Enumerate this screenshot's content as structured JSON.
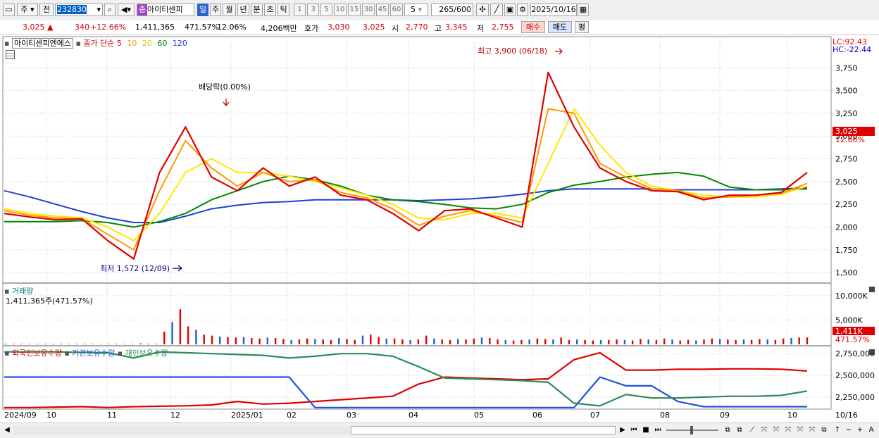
{
  "toolbar": {
    "market_btn": "주",
    "prev_btn": "전",
    "code_value": "232830",
    "name_badge": "종",
    "stock_name": "아이티센피",
    "period_day": "일",
    "period_week": "주",
    "period_month": "월",
    "period_year": "년",
    "period_minute": "분",
    "period_second": "초",
    "period_tick": "틱",
    "intervals": [
      "1",
      "3",
      "5",
      "10",
      "15",
      "30",
      "45",
      "60"
    ],
    "interval_value": "5",
    "count_value": "265",
    "count_total": "/600",
    "date_value": "2025/10/16"
  },
  "info": {
    "price": "3,025",
    "change_symbol": "▲",
    "change": "340",
    "change_pct": "+12.66%",
    "volume": "1,411,365",
    "volume_ratio": "471.57%",
    "turnover": "12.06%",
    "amount": "4,206백만",
    "bid_label": "호가",
    "bid1": "3,030",
    "bid2": "3,025",
    "open_label": "시",
    "open": "2,770",
    "high_label": "고",
    "high": "3,345",
    "low_label": "저",
    "low": "2,755",
    "buy_btn": "매수",
    "sell_btn": "매도",
    "eval_btn": "평"
  },
  "price_panel": {
    "title": "아이티센피엔에스",
    "ma_label": "종가 단순",
    "ma_periods": [
      "5",
      "10",
      "20",
      "60",
      "120"
    ],
    "lc": "LC:92.43",
    "hc": "HC:-22.44",
    "current_price_tag": "3,025",
    "current_pct_tag": "12.66%",
    "high_annotation": "최고 3,900 (06/18)",
    "low_annotation": "최저 1,572 (12/09)",
    "dividend_annotation": "배당락(0.00%)"
  },
  "volume_panel": {
    "title": "거래량",
    "value_line": "1,411,365주(471.57%)",
    "axis": [
      "10,000K",
      "5,000K"
    ],
    "current_tag": "1,411K",
    "pct_tag": "471.57%"
  },
  "holding_panel": {
    "legend_foreign": "외국인보유수량",
    "legend_inst": "기관보유수량",
    "legend_indiv": "개인보유수량",
    "axis": [
      "2,750,000",
      "2,500,000",
      "2,250,000"
    ]
  },
  "x_axis": [
    "2024/09",
    "10",
    "11",
    "12",
    "2025/01",
    "02",
    "03",
    "04",
    "05",
    "06",
    "07",
    "08",
    "09",
    "10",
    "10/16"
  ],
  "chart_data": [
    {
      "type": "line",
      "name": "price",
      "ylim": [
        1400,
        4000
      ],
      "yticks": [
        1500,
        1750,
        2000,
        2250,
        2500,
        2750,
        3000,
        3250,
        3500,
        3750
      ],
      "months": [
        "2024/09",
        "10",
        "11",
        "12",
        "2025/01",
        "02",
        "03",
        "04",
        "05",
        "06",
        "07",
        "08",
        "09",
        "10"
      ],
      "series": [
        {
          "name": "5",
          "color": "#e00000",
          "values": [
            2150,
            2110,
            2080,
            2090,
            1850,
            1650,
            2600,
            3100,
            2550,
            2400,
            2650,
            2450,
            2550,
            2350,
            2300,
            2150,
            1960,
            2180,
            2200,
            2100,
            2000,
            3700,
            3100,
            2650,
            2500,
            2400,
            2390,
            2300,
            2350,
            2350,
            2380,
            2600
          ]
        },
        {
          "name": "10",
          "color": "#ff9900",
          "values": [
            2180,
            2130,
            2100,
            2090,
            1920,
            1750,
            2400,
            2950,
            2650,
            2450,
            2600,
            2500,
            2520,
            2380,
            2320,
            2200,
            2020,
            2120,
            2180,
            2120,
            2050,
            3300,
            3250,
            2700,
            2550,
            2420,
            2400,
            2320,
            2330,
            2350,
            2370,
            2480
          ]
        },
        {
          "name": "20",
          "color": "#ffe600",
          "values": [
            2200,
            2150,
            2120,
            2100,
            2000,
            1850,
            2150,
            2600,
            2750,
            2600,
            2600,
            2560,
            2500,
            2430,
            2350,
            2250,
            2100,
            2080,
            2150,
            2150,
            2100,
            2700,
            3300,
            2900,
            2600,
            2450,
            2400,
            2350,
            2330,
            2330,
            2360,
            2450
          ]
        },
        {
          "name": "60",
          "color": "#008800",
          "values": [
            2060,
            2060,
            2060,
            2070,
            2050,
            2000,
            2060,
            2150,
            2300,
            2400,
            2500,
            2560,
            2520,
            2450,
            2350,
            2300,
            2280,
            2250,
            2210,
            2200,
            2250,
            2380,
            2460,
            2500,
            2550,
            2580,
            2600,
            2560,
            2440,
            2410,
            2410,
            2420
          ]
        },
        {
          "name": "120",
          "color": "#2040d0",
          "values": [
            2400,
            2330,
            2250,
            2170,
            2100,
            2050,
            2050,
            2120,
            2200,
            2240,
            2270,
            2280,
            2300,
            2300,
            2300,
            2300,
            2290,
            2300,
            2310,
            2330,
            2360,
            2400,
            2420,
            2420,
            2420,
            2420,
            2410,
            2410,
            2410,
            2410,
            2420,
            2430
          ]
        }
      ]
    },
    {
      "type": "bar",
      "name": "volume",
      "ylim": [
        0,
        12000
      ],
      "yticks": [
        5000,
        10000
      ],
      "values": [
        150,
        120,
        100,
        110,
        90,
        80,
        100,
        120,
        90,
        110,
        100,
        80,
        70,
        90,
        100,
        80,
        70,
        200,
        150,
        120,
        2600,
        4600,
        7200,
        3700,
        3000,
        2000,
        1800,
        1600,
        1500,
        1400,
        1500,
        1300,
        1200,
        1400,
        1300,
        1100,
        900,
        1000,
        1200,
        1100,
        1000,
        900,
        1300,
        1100,
        900,
        1800,
        2000,
        1500,
        1200,
        1200,
        1000,
        900,
        1000,
        1800,
        1200,
        1000,
        900,
        1100,
        1000,
        1200,
        1400,
        1300,
        1000,
        900,
        800,
        900,
        1000,
        1200,
        1100,
        1000,
        1400,
        900,
        1000,
        900,
        800,
        900,
        900,
        1000,
        900,
        800,
        1100,
        1000,
        900,
        1200,
        1000,
        800,
        900,
        800,
        1000,
        1200,
        1100,
        1000,
        900,
        1000,
        900,
        1100,
        1000,
        900,
        1200,
        1300,
        1400,
        1411
      ]
    },
    {
      "type": "line",
      "name": "holdings",
      "ylim": [
        2120000,
        2800000
      ],
      "yticks": [
        2250000,
        2500000,
        2750000
      ],
      "series": [
        {
          "name": "외국인보유수량",
          "color": "#e00000",
          "values": [
            2130000,
            2130000,
            2135000,
            2140000,
            2130000,
            2140000,
            2145000,
            2150000,
            2160000,
            2200000,
            2170000,
            2180000,
            2200000,
            2220000,
            2240000,
            2260000,
            2400000,
            2480000,
            2470000,
            2460000,
            2450000,
            2460000,
            2680000,
            2760000,
            2560000,
            2560000,
            2570000,
            2570000,
            2575000,
            2575000,
            2570000,
            2550000
          ]
        },
        {
          "name": "기관보유수량",
          "color": "#2050e0",
          "values": [
            2480000,
            2480000,
            2480000,
            2480000,
            2480000,
            2480000,
            2480000,
            2480000,
            2480000,
            2480000,
            2480000,
            2480000,
            2130000,
            2130000,
            2130000,
            2130000,
            2130000,
            2130000,
            2130000,
            2130000,
            2130000,
            2130000,
            2130000,
            2480000,
            2380000,
            2380000,
            2200000,
            2140000,
            2140000,
            2140000,
            2140000,
            2140000
          ]
        },
        {
          "name": "개인보유수량",
          "color": "#2e8b57",
          "values": [
            2770000,
            2770000,
            2770000,
            2765000,
            2760000,
            2700000,
            2770000,
            2760000,
            2750000,
            2740000,
            2730000,
            2700000,
            2720000,
            2750000,
            2750000,
            2720000,
            2600000,
            2470000,
            2460000,
            2450000,
            2440000,
            2420000,
            2180000,
            2150000,
            2280000,
            2240000,
            2240000,
            2250000,
            2260000,
            2260000,
            2270000,
            2320000
          ]
        }
      ]
    }
  ]
}
